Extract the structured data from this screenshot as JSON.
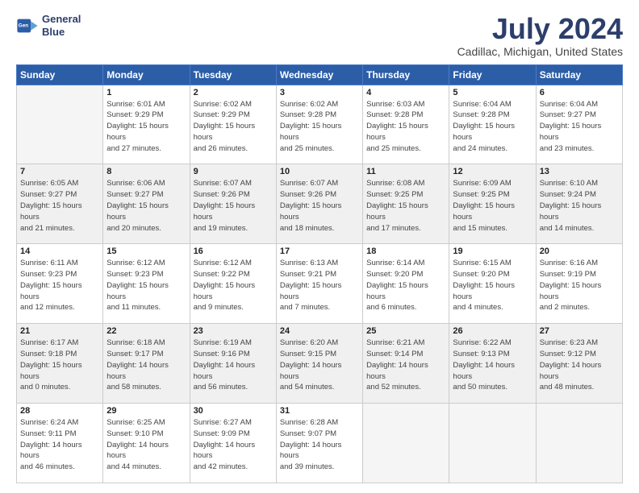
{
  "header": {
    "logo_line1": "General",
    "logo_line2": "Blue",
    "title": "July 2024",
    "subtitle": "Cadillac, Michigan, United States"
  },
  "days_of_week": [
    "Sunday",
    "Monday",
    "Tuesday",
    "Wednesday",
    "Thursday",
    "Friday",
    "Saturday"
  ],
  "weeks": [
    [
      {
        "day": "",
        "empty": true
      },
      {
        "day": "1",
        "sunrise": "6:01 AM",
        "sunset": "9:29 PM",
        "daylight": "15 hours and 27 minutes."
      },
      {
        "day": "2",
        "sunrise": "6:02 AM",
        "sunset": "9:29 PM",
        "daylight": "15 hours and 26 minutes."
      },
      {
        "day": "3",
        "sunrise": "6:02 AM",
        "sunset": "9:28 PM",
        "daylight": "15 hours and 25 minutes."
      },
      {
        "day": "4",
        "sunrise": "6:03 AM",
        "sunset": "9:28 PM",
        "daylight": "15 hours and 25 minutes."
      },
      {
        "day": "5",
        "sunrise": "6:04 AM",
        "sunset": "9:28 PM",
        "daylight": "15 hours and 24 minutes."
      },
      {
        "day": "6",
        "sunrise": "6:04 AM",
        "sunset": "9:27 PM",
        "daylight": "15 hours and 23 minutes."
      }
    ],
    [
      {
        "day": "7",
        "sunrise": "6:05 AM",
        "sunset": "9:27 PM",
        "daylight": "15 hours and 21 minutes."
      },
      {
        "day": "8",
        "sunrise": "6:06 AM",
        "sunset": "9:27 PM",
        "daylight": "15 hours and 20 minutes."
      },
      {
        "day": "9",
        "sunrise": "6:07 AM",
        "sunset": "9:26 PM",
        "daylight": "15 hours and 19 minutes."
      },
      {
        "day": "10",
        "sunrise": "6:07 AM",
        "sunset": "9:26 PM",
        "daylight": "15 hours and 18 minutes."
      },
      {
        "day": "11",
        "sunrise": "6:08 AM",
        "sunset": "9:25 PM",
        "daylight": "15 hours and 17 minutes."
      },
      {
        "day": "12",
        "sunrise": "6:09 AM",
        "sunset": "9:25 PM",
        "daylight": "15 hours and 15 minutes."
      },
      {
        "day": "13",
        "sunrise": "6:10 AM",
        "sunset": "9:24 PM",
        "daylight": "15 hours and 14 minutes."
      }
    ],
    [
      {
        "day": "14",
        "sunrise": "6:11 AM",
        "sunset": "9:23 PM",
        "daylight": "15 hours and 12 minutes."
      },
      {
        "day": "15",
        "sunrise": "6:12 AM",
        "sunset": "9:23 PM",
        "daylight": "15 hours and 11 minutes."
      },
      {
        "day": "16",
        "sunrise": "6:12 AM",
        "sunset": "9:22 PM",
        "daylight": "15 hours and 9 minutes."
      },
      {
        "day": "17",
        "sunrise": "6:13 AM",
        "sunset": "9:21 PM",
        "daylight": "15 hours and 7 minutes."
      },
      {
        "day": "18",
        "sunrise": "6:14 AM",
        "sunset": "9:20 PM",
        "daylight": "15 hours and 6 minutes."
      },
      {
        "day": "19",
        "sunrise": "6:15 AM",
        "sunset": "9:20 PM",
        "daylight": "15 hours and 4 minutes."
      },
      {
        "day": "20",
        "sunrise": "6:16 AM",
        "sunset": "9:19 PM",
        "daylight": "15 hours and 2 minutes."
      }
    ],
    [
      {
        "day": "21",
        "sunrise": "6:17 AM",
        "sunset": "9:18 PM",
        "daylight": "15 hours and 0 minutes."
      },
      {
        "day": "22",
        "sunrise": "6:18 AM",
        "sunset": "9:17 PM",
        "daylight": "14 hours and 58 minutes."
      },
      {
        "day": "23",
        "sunrise": "6:19 AM",
        "sunset": "9:16 PM",
        "daylight": "14 hours and 56 minutes."
      },
      {
        "day": "24",
        "sunrise": "6:20 AM",
        "sunset": "9:15 PM",
        "daylight": "14 hours and 54 minutes."
      },
      {
        "day": "25",
        "sunrise": "6:21 AM",
        "sunset": "9:14 PM",
        "daylight": "14 hours and 52 minutes."
      },
      {
        "day": "26",
        "sunrise": "6:22 AM",
        "sunset": "9:13 PM",
        "daylight": "14 hours and 50 minutes."
      },
      {
        "day": "27",
        "sunrise": "6:23 AM",
        "sunset": "9:12 PM",
        "daylight": "14 hours and 48 minutes."
      }
    ],
    [
      {
        "day": "28",
        "sunrise": "6:24 AM",
        "sunset": "9:11 PM",
        "daylight": "14 hours and 46 minutes."
      },
      {
        "day": "29",
        "sunrise": "6:25 AM",
        "sunset": "9:10 PM",
        "daylight": "14 hours and 44 minutes."
      },
      {
        "day": "30",
        "sunrise": "6:27 AM",
        "sunset": "9:09 PM",
        "daylight": "14 hours and 42 minutes."
      },
      {
        "day": "31",
        "sunrise": "6:28 AM",
        "sunset": "9:07 PM",
        "daylight": "14 hours and 39 minutes."
      },
      {
        "day": "",
        "empty": true
      },
      {
        "day": "",
        "empty": true
      },
      {
        "day": "",
        "empty": true
      }
    ]
  ]
}
